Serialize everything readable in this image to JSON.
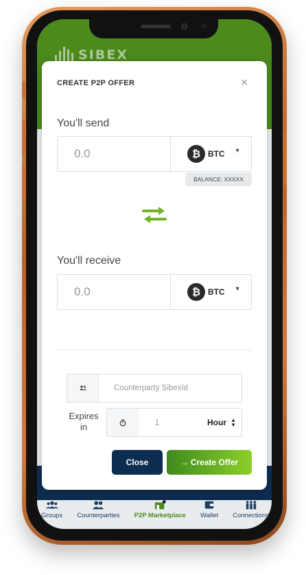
{
  "app": {
    "logo_text": "SIBEX"
  },
  "modal": {
    "title": "CREATE P2P OFFER",
    "close_symbol": "×",
    "send": {
      "label": "You'll send",
      "amount_placeholder": "0.0",
      "currency": "BTC",
      "currency_icon": "bitcoin-icon",
      "balance": "BALANCE: XXXXX"
    },
    "swap_icon": "swap-arrows-icon",
    "receive": {
      "label": "You'll receive",
      "amount_placeholder": "0.0",
      "currency": "BTC",
      "currency_icon": "bitcoin-icon"
    },
    "counterparty_placeholder": "Counterparty SibexId",
    "expires": {
      "label": "Expires in",
      "value": "1",
      "unit": "Hour"
    },
    "close_button": "Close",
    "create_button": "Create Offer"
  },
  "bottom_nav": {
    "items": [
      {
        "label": "Groups",
        "icon": "groups-icon",
        "active": false
      },
      {
        "label": "Counterparties",
        "icon": "counterparties-icon",
        "active": false
      },
      {
        "label": "P2P Marketplace",
        "icon": "marketplace-icon",
        "active": true
      },
      {
        "label": "Wallet",
        "icon": "wallet-icon",
        "active": false
      },
      {
        "label": "Connections",
        "icon": "connections-icon",
        "active": false
      }
    ]
  },
  "colors": {
    "brand_green": "#4c8a1c",
    "navy": "#0d2d50",
    "accent_green": "#8ccf2a",
    "frame_copper": "#c8702f"
  }
}
